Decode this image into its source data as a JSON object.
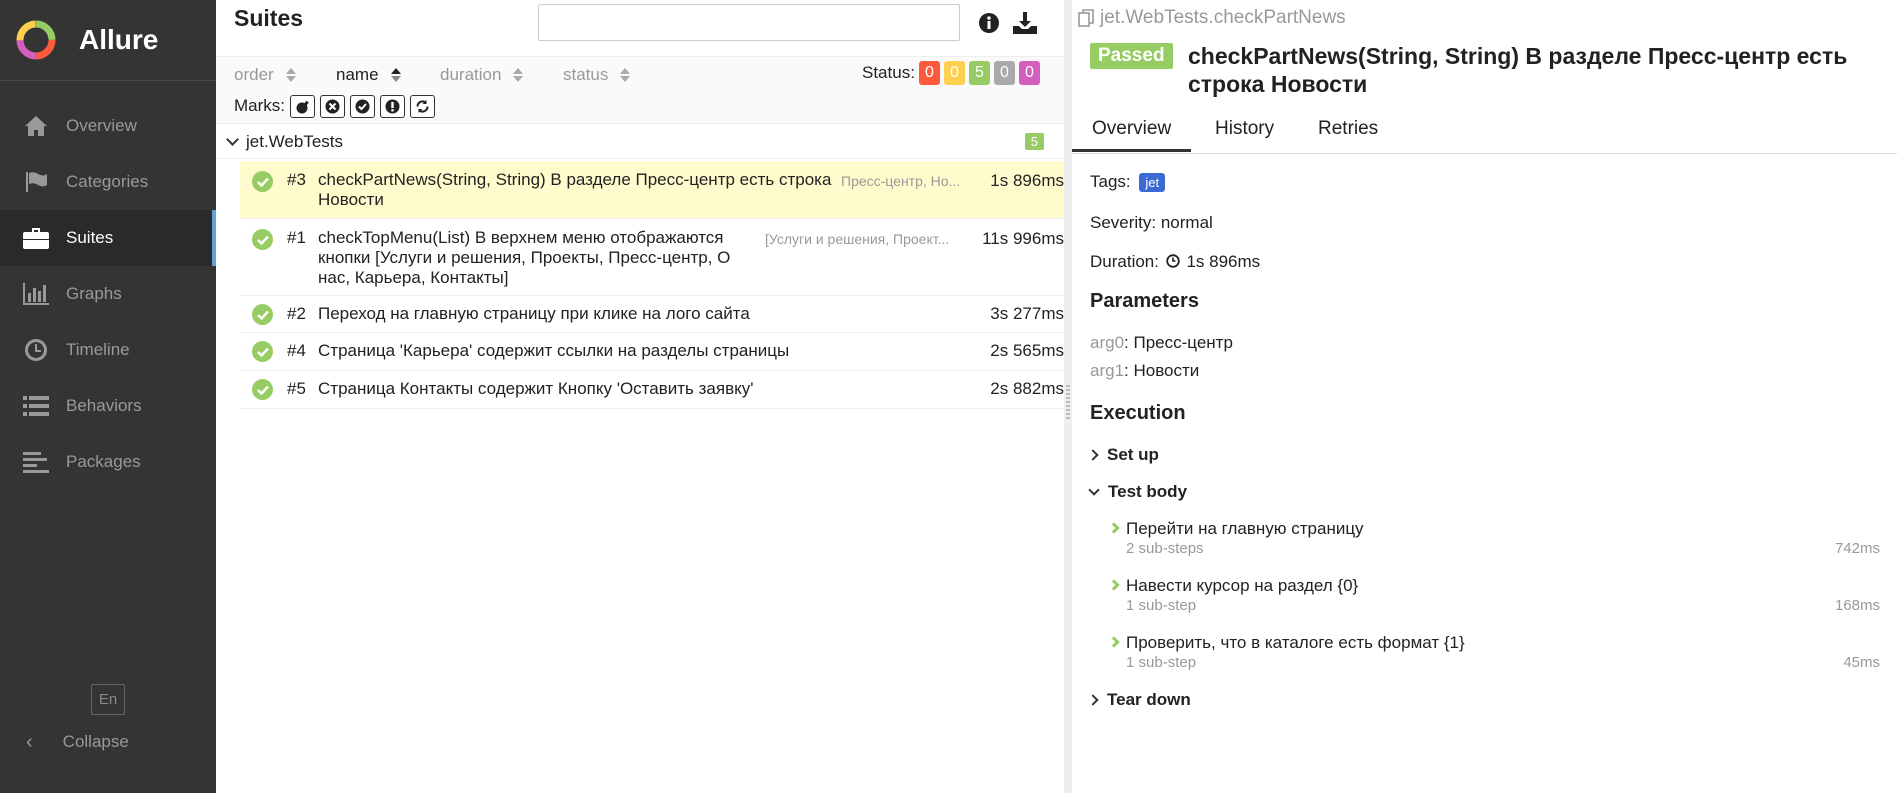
{
  "app": {
    "name": "Allure"
  },
  "sidebar": {
    "items": [
      {
        "label": "Overview",
        "icon": "home-icon"
      },
      {
        "label": "Categories",
        "icon": "flag-icon"
      },
      {
        "label": "Suites",
        "icon": "briefcase-icon",
        "active": true
      },
      {
        "label": "Graphs",
        "icon": "bar-chart-icon"
      },
      {
        "label": "Timeline",
        "icon": "clock-icon"
      },
      {
        "label": "Behaviors",
        "icon": "list-icon"
      },
      {
        "label": "Packages",
        "icon": "align-left-icon"
      }
    ],
    "language": "En",
    "collapse_label": "Collapse"
  },
  "suites": {
    "title": "Suites",
    "search": {
      "value": "",
      "placeholder": ""
    },
    "sort": {
      "order": "order",
      "name": "name",
      "duration": "duration",
      "status": "status"
    },
    "status_label": "Status:",
    "status_counts": [
      {
        "value": "0",
        "color": "#fd5a3e"
      },
      {
        "value": "0",
        "color": "#ffd050"
      },
      {
        "value": "5",
        "color": "#97cc64"
      },
      {
        "value": "0",
        "color": "#aaaaaa"
      },
      {
        "value": "0",
        "color": "#d35ebe"
      }
    ],
    "marks_label": "Marks:",
    "group": {
      "name": "jet.WebTests",
      "count": "5"
    },
    "tests": [
      {
        "num": "#3",
        "name": "checkPartNews(String, String) В разделе Пресс-центр есть строка Новости",
        "params": "Пресс-центр, Но...",
        "duration": "1s 896ms"
      },
      {
        "num": "#1",
        "name": "checkTopMenu(List) В верхнем меню отображаются кнопки [Услуги и решения, Проекты, Пресс-центр, О нас, Карьера, Контакты]",
        "params": "[Услуги и решения, Проект...",
        "duration": "11s 996ms"
      },
      {
        "num": "#2",
        "name": "Переход на главную страницу при клике на лого сайта",
        "params": "",
        "duration": "3s 277ms"
      },
      {
        "num": "#4",
        "name": "Страница 'Карьера' содержит ссылки на разделы страницы",
        "params": "",
        "duration": "2s 565ms"
      },
      {
        "num": "#5",
        "name": "Страница Контакты содержит Кнопку 'Оставить заявку'",
        "params": "",
        "duration": "2s 882ms"
      }
    ]
  },
  "detail": {
    "path": "jet.WebTests.checkPartNews",
    "status": "Passed",
    "title": "checkPartNews(String, String) В разделе Пресс-центр есть строка Новости",
    "tabs": [
      "Overview",
      "History",
      "Retries"
    ],
    "tags_label": "Tags:",
    "tag": "jet",
    "severity": "Severity: normal",
    "duration_label": "Duration:",
    "duration": "1s 896ms",
    "parameters_heading": "Parameters",
    "params": [
      {
        "key": "arg0",
        "value": "Пресс-центр"
      },
      {
        "key": "arg1",
        "value": "Новости"
      }
    ],
    "execution_heading": "Execution",
    "setup": "Set up",
    "test_body": "Test body",
    "steps": [
      {
        "name": "Перейти на главную страницу",
        "sub": "2 sub-steps",
        "duration": "742ms"
      },
      {
        "name": "Навести курсор на раздел {0}",
        "sub": "1 sub-step",
        "duration": "168ms"
      },
      {
        "name": "Проверить, что в каталоге есть формат {1}",
        "sub": "1 sub-step",
        "duration": "45ms"
      }
    ],
    "teardown": "Tear down"
  }
}
